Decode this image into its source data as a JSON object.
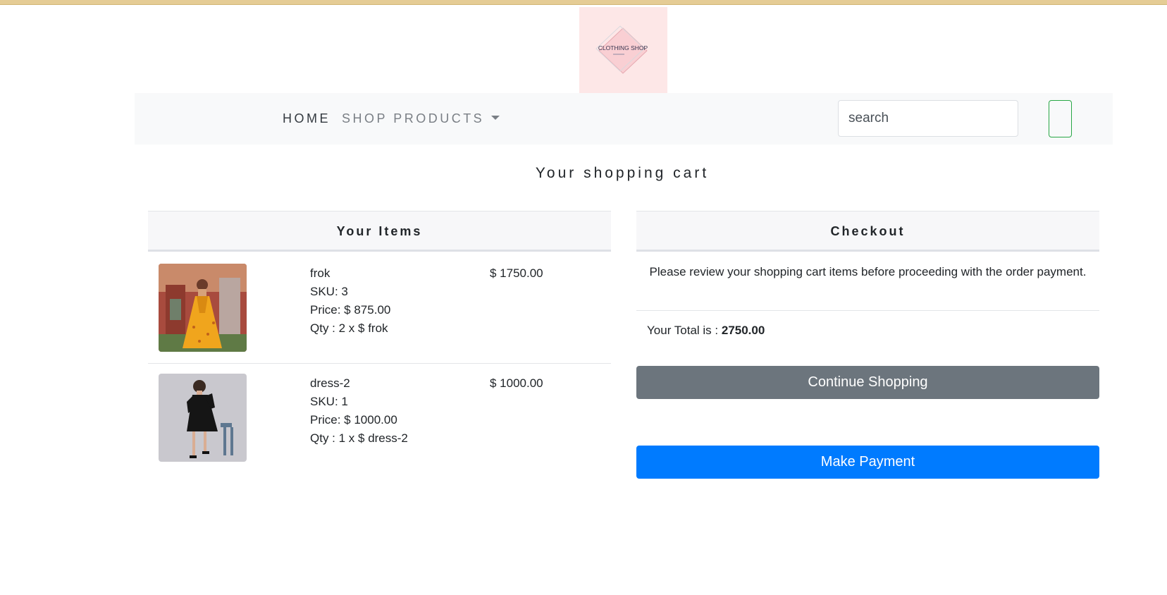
{
  "logo": {
    "text": "CLOTHING SHOP"
  },
  "nav": {
    "home_label": "HOME",
    "shop_label": "SHOP PRODUCTS"
  },
  "search": {
    "placeholder": "search"
  },
  "page_title": "Your shopping cart",
  "items_section": {
    "heading": "Your Items",
    "items": [
      {
        "name": "frok",
        "sku": "SKU: 3",
        "price": "Price: $ 875.00",
        "qty": "Qty : 2 x $ frok",
        "total": "$ 1750.00"
      },
      {
        "name": "dress-2",
        "sku": "SKU: 1",
        "price": "Price: $ 1000.00",
        "qty": "Qty : 1 x $ dress-2",
        "total": "$ 1000.00"
      }
    ]
  },
  "checkout": {
    "heading": "Checkout",
    "review_text": "Please review your shopping cart items before proceeding with the order payment.",
    "total_label": "Your Total is :",
    "total_value": "2750.00",
    "continue_label": "Continue Shopping",
    "pay_label": "Make Payment"
  },
  "colors": {
    "continue": "#6c757d",
    "pay": "#007bff",
    "search_button_border": "#28a745",
    "logo_bg": "#fde7e7"
  }
}
